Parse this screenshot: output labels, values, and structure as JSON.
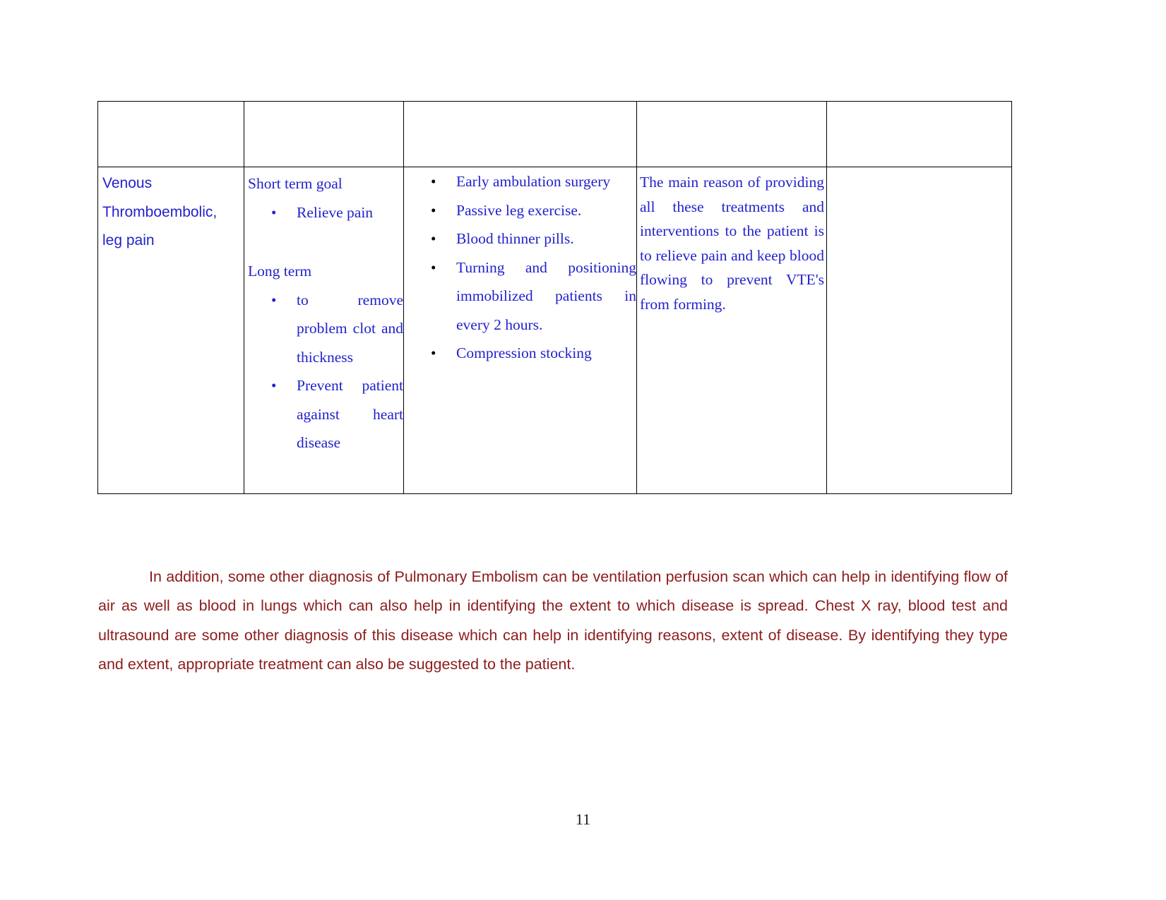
{
  "document": {
    "page_number": "11",
    "colors": {
      "blue_text": "#2222cc",
      "maroon_text": "#8c1c1c",
      "border": "#000000",
      "page_number_text": "#1a1a1a"
    }
  },
  "table": {
    "header_row": {
      "cells": [
        "",
        "",
        "",
        "",
        ""
      ]
    },
    "body_row": {
      "diagnosis": {
        "lines": [
          "Venous",
          "Thromboembolic,",
          "leg pain"
        ],
        "text": "Venous Thromboembolic, leg pain"
      },
      "goals": {
        "short_term_heading": "Short term goal",
        "short_term_items": [
          "Relieve pain"
        ],
        "long_term_heading": "Long term",
        "long_term_items": [
          "to remove problem clot and thickness",
          "Prevent patient against heart disease"
        ]
      },
      "interventions": {
        "items": [
          "Early ambulation surgery",
          "Passive leg exercise.",
          "Blood thinner pills.",
          "Turning and positioning immobilized patients in every 2 hours.",
          "Compression stocking"
        ]
      },
      "rationale": {
        "text": "The main reason of providing all these treatments and interventions to the patient is to relieve pain and keep blood flowing to prevent VTE's from forming."
      },
      "evaluation": {
        "text": ""
      }
    }
  },
  "paragraph": {
    "text": "In addition, some other diagnosis of Pulmonary Embolism can be ventilation perfusion scan which can help in identifying flow of air as well as blood in lungs which can also help in identifying the extent to which disease is spread. Chest X ray, blood test and ultrasound are some other diagnosis of this disease which can help in identifying reasons, extent of disease. By identifying they type and extent, appropriate treatment can also be suggested to the patient."
  }
}
